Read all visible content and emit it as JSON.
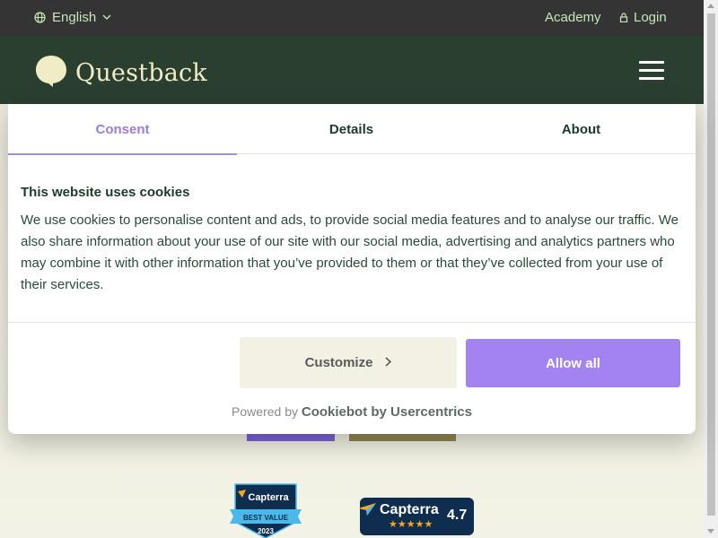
{
  "topbar": {
    "language": "English",
    "academy": "Academy",
    "login": "Login"
  },
  "header": {
    "logo_text": "Questback",
    "menu_icon": "hamburger-icon"
  },
  "modal": {
    "tabs": [
      {
        "label": "Consent",
        "active": true
      },
      {
        "label": "Details",
        "active": false
      },
      {
        "label": "About",
        "active": false
      }
    ],
    "title": "This website uses cookies",
    "body": "We use cookies to personalise content and ads, to provide social media features and to analyse our traffic. We also share information about your use of our site with our social media, advertising and analytics partners who may combine it with other information that you’ve provided to them or that they’ve collected from your use of their services.",
    "customize_label": "Customize",
    "allow_all_label": "Allow all",
    "powered_by_prefix": "Powered by",
    "powered_by_brand": "Cookiebot by Usercentrics"
  },
  "badges": {
    "best_value": {
      "brand": "Capterra",
      "ribbon": "BEST VALUE",
      "year": "2023"
    },
    "rating": {
      "brand": "Capterra",
      "stars": "★★★★★",
      "score": "4.7"
    }
  },
  "colors": {
    "topbar_bg": "#343434",
    "header_bg": "#2b3f31",
    "accent_purple": "#a283f0",
    "logo_cream": "#f0ecc6"
  }
}
